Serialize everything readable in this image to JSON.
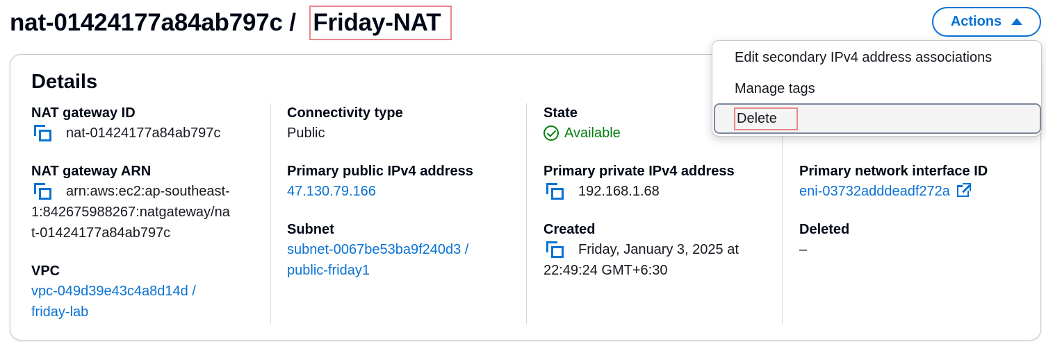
{
  "header": {
    "id_prefix": "nat-01424177a84ab797c / ",
    "name": "Friday-NAT",
    "actions_label": "Actions"
  },
  "details": {
    "heading": "Details",
    "nat_gateway_id": {
      "label": "NAT gateway ID",
      "value": "nat-01424177a84ab797c"
    },
    "nat_gateway_arn": {
      "label": "NAT gateway ARN",
      "value_line1": "arn:aws:ec2:ap-southeast-",
      "value_line2": "1:842675988267:natgateway/na",
      "value_line3": "t-01424177a84ab797c"
    },
    "vpc": {
      "label": "VPC",
      "value_line1": "vpc-049d39e43c4a8d14d /",
      "value_line2": "friday-lab"
    },
    "connectivity_type": {
      "label": "Connectivity type",
      "value": "Public"
    },
    "primary_public_ipv4": {
      "label": "Primary public IPv4 address",
      "value": "47.130.79.166"
    },
    "subnet": {
      "label": "Subnet",
      "value_line1": "subnet-0067be53ba9f240d3 /",
      "value_line2": "public-friday1"
    },
    "state": {
      "label": "State",
      "value": "Available",
      "color": "#037f0c"
    },
    "primary_private_ipv4": {
      "label": "Primary private IPv4 address",
      "value": "192.168.1.68"
    },
    "created": {
      "label": "Created",
      "value_line1": "Friday, January 3, 2025 at",
      "value_line2": "22:49:24 GMT+6:30"
    },
    "primary_network_interface": {
      "label": "Primary network interface ID",
      "value": "eni-03732adddeadf272a"
    },
    "deleted": {
      "label": "Deleted",
      "value": "–"
    }
  },
  "actions_menu": {
    "items": [
      {
        "label": "Edit secondary IPv4 address associations"
      },
      {
        "label": "Manage tags"
      },
      {
        "label": "Delete"
      }
    ]
  },
  "colors": {
    "link": "#0972d3",
    "success": "#037f0c",
    "highlight_box": "#e8868a"
  }
}
